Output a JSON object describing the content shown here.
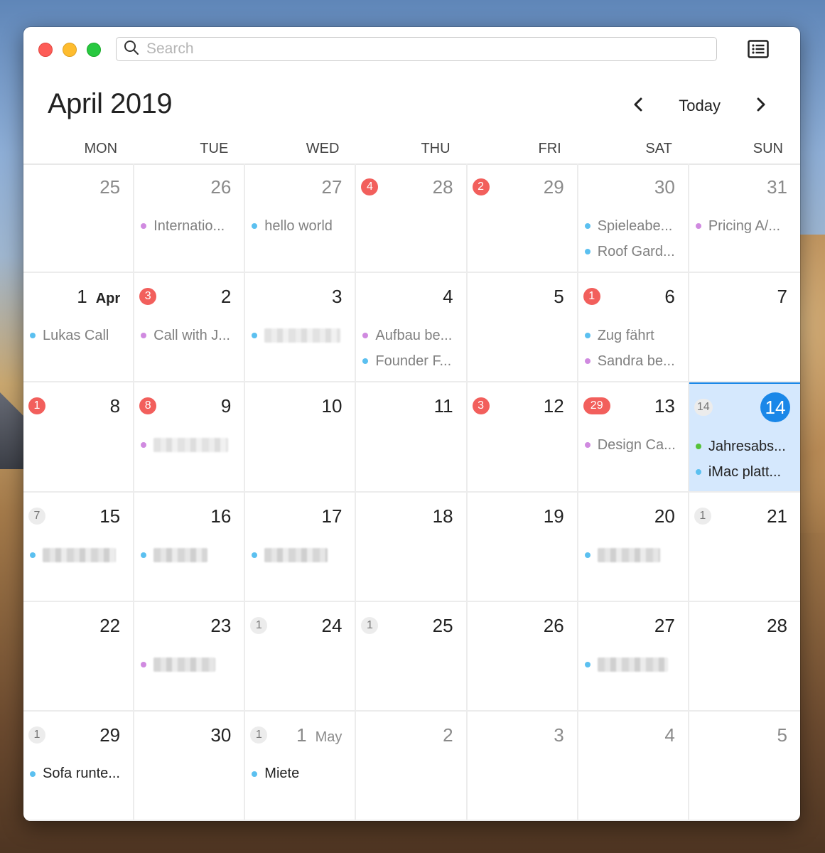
{
  "window": {
    "search_placeholder": "Search",
    "month_title": "April 2019",
    "today_label": "Today"
  },
  "icons": {
    "search": "search-icon",
    "list": "list-view-icon",
    "prev": "chevron-left-icon",
    "next": "chevron-right-icon"
  },
  "colors": {
    "accent": "#1a87e8",
    "badge_red": "#f25f5c",
    "event_blue": "#5bc0f0",
    "event_purple": "#d08ae0",
    "event_green": "#55c23a",
    "today_bg": "#d5e8fd"
  },
  "weekdays": [
    "MON",
    "TUE",
    "WED",
    "THU",
    "FRI",
    "SAT",
    "SUN"
  ],
  "weeks": [
    [
      {
        "day": "25",
        "other": true,
        "events": []
      },
      {
        "day": "26",
        "other": true,
        "events": [
          {
            "title": "Internatio...",
            "color": "purple",
            "past": true
          }
        ]
      },
      {
        "day": "27",
        "other": true,
        "events": [
          {
            "title": "hello world",
            "color": "blue",
            "past": true
          }
        ]
      },
      {
        "day": "28",
        "other": true,
        "badge": "4",
        "badge_type": "red",
        "events": []
      },
      {
        "day": "29",
        "other": true,
        "badge": "2",
        "badge_type": "red",
        "events": []
      },
      {
        "day": "30",
        "other": true,
        "events": [
          {
            "title": "Spieleabe...",
            "color": "blue",
            "past": true
          },
          {
            "title": "Roof Gard...",
            "color": "blue",
            "past": true
          }
        ]
      },
      {
        "day": "31",
        "other": true,
        "events": [
          {
            "title": "Pricing A/...",
            "color": "purple",
            "past": true
          }
        ]
      }
    ],
    [
      {
        "day": "1",
        "month": "Apr",
        "events": [
          {
            "title": "Lukas Call",
            "color": "blue",
            "past": true
          }
        ]
      },
      {
        "day": "2",
        "badge": "3",
        "badge_type": "red",
        "events": [
          {
            "title": "Call with J...",
            "color": "purple",
            "past": true
          }
        ]
      },
      {
        "day": "3",
        "events": [
          {
            "title": "",
            "blurred": true,
            "color": "blue",
            "past": true
          }
        ]
      },
      {
        "day": "4",
        "events": [
          {
            "title": "Aufbau be...",
            "color": "purple",
            "past": true
          },
          {
            "title": "Founder F...",
            "color": "blue",
            "past": true
          }
        ]
      },
      {
        "day": "5",
        "events": []
      },
      {
        "day": "6",
        "badge": "1",
        "badge_type": "red",
        "events": [
          {
            "title": "Zug fährt",
            "color": "blue",
            "past": true
          },
          {
            "title": "Sandra be...",
            "color": "purple",
            "past": true
          }
        ]
      },
      {
        "day": "7",
        "events": []
      }
    ],
    [
      {
        "day": "8",
        "badge": "1",
        "badge_type": "red",
        "events": []
      },
      {
        "day": "9",
        "badge": "8",
        "badge_type": "red",
        "events": [
          {
            "title": "",
            "blurred": true,
            "color": "purple",
            "past": true
          }
        ]
      },
      {
        "day": "10",
        "events": []
      },
      {
        "day": "11",
        "events": []
      },
      {
        "day": "12",
        "badge": "3",
        "badge_type": "red",
        "events": []
      },
      {
        "day": "13",
        "badge": "29",
        "badge_type": "red",
        "events": [
          {
            "title": "Design Ca...",
            "color": "purple",
            "past": true
          }
        ]
      },
      {
        "day": "14",
        "today": true,
        "badge": "14",
        "badge_type": "gray",
        "events": [
          {
            "title": "Jahresabs...",
            "color": "green",
            "past": false
          },
          {
            "title": "iMac platt...",
            "color": "blue",
            "past": false
          }
        ]
      }
    ],
    [
      {
        "day": "15",
        "badge": "7",
        "badge_type": "gray",
        "events": [
          {
            "title": "",
            "blurred": true,
            "color": "blue",
            "past": false
          }
        ]
      },
      {
        "day": "16",
        "events": [
          {
            "title": "",
            "blurred": true,
            "color": "blue",
            "past": false
          }
        ]
      },
      {
        "day": "17",
        "events": [
          {
            "title": "",
            "blurred": true,
            "color": "blue",
            "past": false
          }
        ]
      },
      {
        "day": "18",
        "events": []
      },
      {
        "day": "19",
        "events": []
      },
      {
        "day": "20",
        "events": [
          {
            "title": "",
            "blurred": true,
            "color": "blue",
            "past": false
          }
        ]
      },
      {
        "day": "21",
        "badge": "1",
        "badge_type": "gray",
        "events": []
      }
    ],
    [
      {
        "day": "22",
        "events": []
      },
      {
        "day": "23",
        "events": [
          {
            "title": "",
            "blurred": true,
            "color": "purple",
            "past": false
          }
        ]
      },
      {
        "day": "24",
        "badge": "1",
        "badge_type": "gray",
        "events": []
      },
      {
        "day": "25",
        "badge": "1",
        "badge_type": "gray",
        "events": []
      },
      {
        "day": "26",
        "events": []
      },
      {
        "day": "27",
        "events": [
          {
            "title": "",
            "blurred": true,
            "color": "blue",
            "past": false
          }
        ]
      },
      {
        "day": "28",
        "events": []
      }
    ],
    [
      {
        "day": "29",
        "badge": "1",
        "badge_type": "gray",
        "events": [
          {
            "title": "Sofa runte...",
            "color": "blue",
            "past": false
          }
        ]
      },
      {
        "day": "30",
        "events": []
      },
      {
        "day": "1",
        "month": "May",
        "other": true,
        "badge": "1",
        "badge_type": "gray",
        "events": [
          {
            "title": "Miete",
            "color": "blue",
            "past": false
          }
        ]
      },
      {
        "day": "2",
        "other": true,
        "events": []
      },
      {
        "day": "3",
        "other": true,
        "events": []
      },
      {
        "day": "4",
        "other": true,
        "events": []
      },
      {
        "day": "5",
        "other": true,
        "events": []
      }
    ]
  ]
}
